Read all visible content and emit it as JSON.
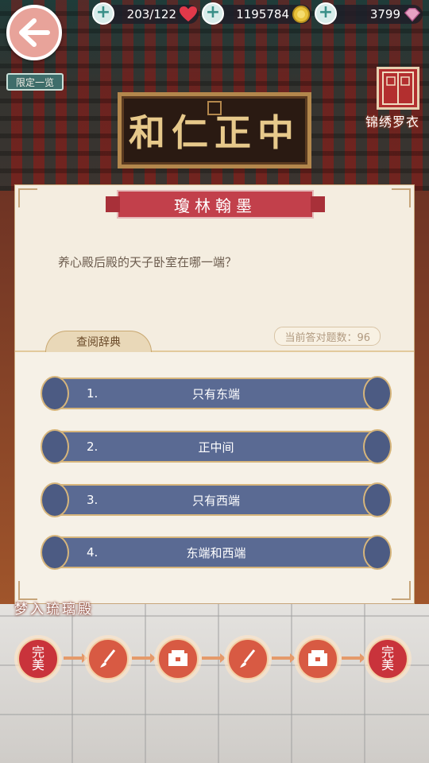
{
  "header": {
    "stamina": "203/122",
    "coins": "1195784",
    "gems": "3799",
    "limited_label": "限定一览",
    "side_label": "锦绣罗衣"
  },
  "scene": {
    "plaque_text": "中正仁和",
    "hall_name": "梦入琉璃殿"
  },
  "quiz": {
    "title": "瓊林翰墨",
    "question": "养心殿后殿的天子卧室在哪一端？",
    "count_label": "当前答对题数：96",
    "dictionary_tab": "查阅辞典",
    "options": [
      {
        "num": "1.",
        "text": "只有东端"
      },
      {
        "num": "2.",
        "text": "正中间"
      },
      {
        "num": "3.",
        "text": "只有西端"
      },
      {
        "num": "4.",
        "text": "东端和西端"
      }
    ]
  },
  "progress": {
    "start_label": "完美",
    "end_label": "完美",
    "steps": [
      "brush-icon",
      "chest-icon",
      "brush-icon",
      "chest-icon"
    ]
  },
  "colors": {
    "option_fill": "#5a6a93",
    "title_banner": "#c2404b",
    "panel": "#f6f1e7"
  }
}
